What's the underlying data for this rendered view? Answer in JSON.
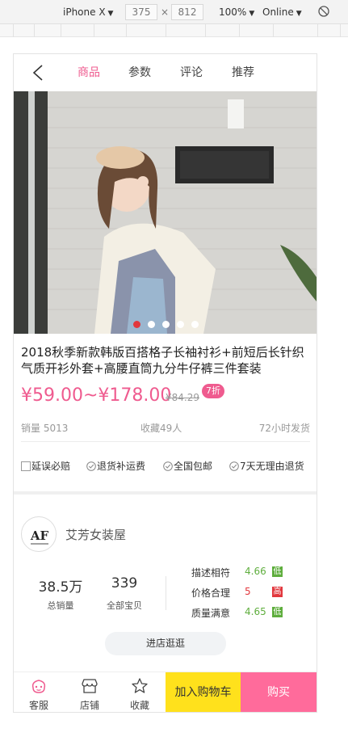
{
  "devtools": {
    "device": "iPhone X",
    "width": "375",
    "times": "×",
    "height": "812",
    "zoom": "100%",
    "network": "Online"
  },
  "nav": {
    "tabs": [
      "商品",
      "参数",
      "评论",
      "推荐"
    ],
    "active_tab": "商品"
  },
  "carousel": {
    "slide_count": 5,
    "active_index": 0
  },
  "product": {
    "title": "2018秋季新款韩版百搭格子长袖衬衫+前短后长针织气质开衫外套+高腰直筒九分牛仔裤三件套装",
    "price_range": "¥59.00~¥178.00",
    "original_price": "¥84.29",
    "discount": "7折",
    "sales": "销量 5013",
    "favorites": "收藏49人",
    "shipping": "72小时发货"
  },
  "services": [
    "延误必赔",
    "退货补运费",
    "全国包邮",
    "7天无理由退货"
  ],
  "shop": {
    "logo_text": "AF",
    "name": "艾芳女装屋",
    "total_sales_value": "38.5万",
    "total_sales_label": "总销量",
    "items_value": "339",
    "items_label": "全部宝贝",
    "ratings": [
      {
        "label": "描述相符",
        "value": "4.66",
        "tag": "低",
        "color": "#5fae3e"
      },
      {
        "label": "价格合理",
        "value": "5",
        "tag": "高",
        "color": "#e2373d"
      },
      {
        "label": "质量满意",
        "value": "4.65",
        "tag": "低",
        "color": "#5fae3e"
      }
    ],
    "visit_label": "进店逛逛"
  },
  "bottom_bar": {
    "service": "客服",
    "store": "店铺",
    "favorite": "收藏",
    "add_to_cart": "加入购物车",
    "buy": "购买"
  },
  "colors": {
    "accent_pink": "#ef5b8f",
    "cart_yellow": "#ffe11c",
    "buy_pink": "#ff6b9b",
    "dot_active": "#e2373d"
  }
}
